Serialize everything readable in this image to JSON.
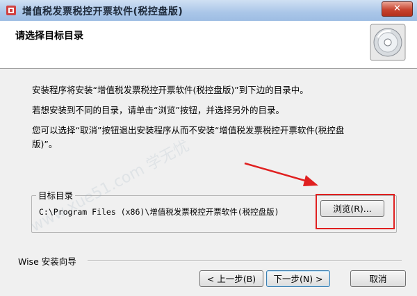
{
  "window": {
    "title": "增值税发票税控开票软件(税控盘版)",
    "close_label": "✕"
  },
  "header": {
    "title": "请选择目标目录"
  },
  "body": {
    "p1": "安装程序将安装“增值税发票税控开票软件(税控盘版)”到下边的目录中。",
    "p2": "若想安装到不同的目录，请单击“浏览”按钮，并选择另外的目录。",
    "p3": "您可以选择“取消”按钮退出安装程序从而不安装“增值税发票税控开票软件(税控盘版)”。"
  },
  "target_dir": {
    "label": "目标目录",
    "path": "C:\\Program Files (x86)\\增值税发票税控开票软件(税控盘版)",
    "browse_label": "浏览(R)..."
  },
  "footer": {
    "wise_label": "Wise 安装向导",
    "back_label": "< 上一步(B)",
    "next_label": "下一步(N) >",
    "cancel_label": "取消"
  },
  "watermark": {
    "text": "www.xue51.com 学无忧"
  },
  "colors": {
    "highlight": "#e02020",
    "titlebar": "#aac6e8",
    "close": "#c7432f"
  }
}
